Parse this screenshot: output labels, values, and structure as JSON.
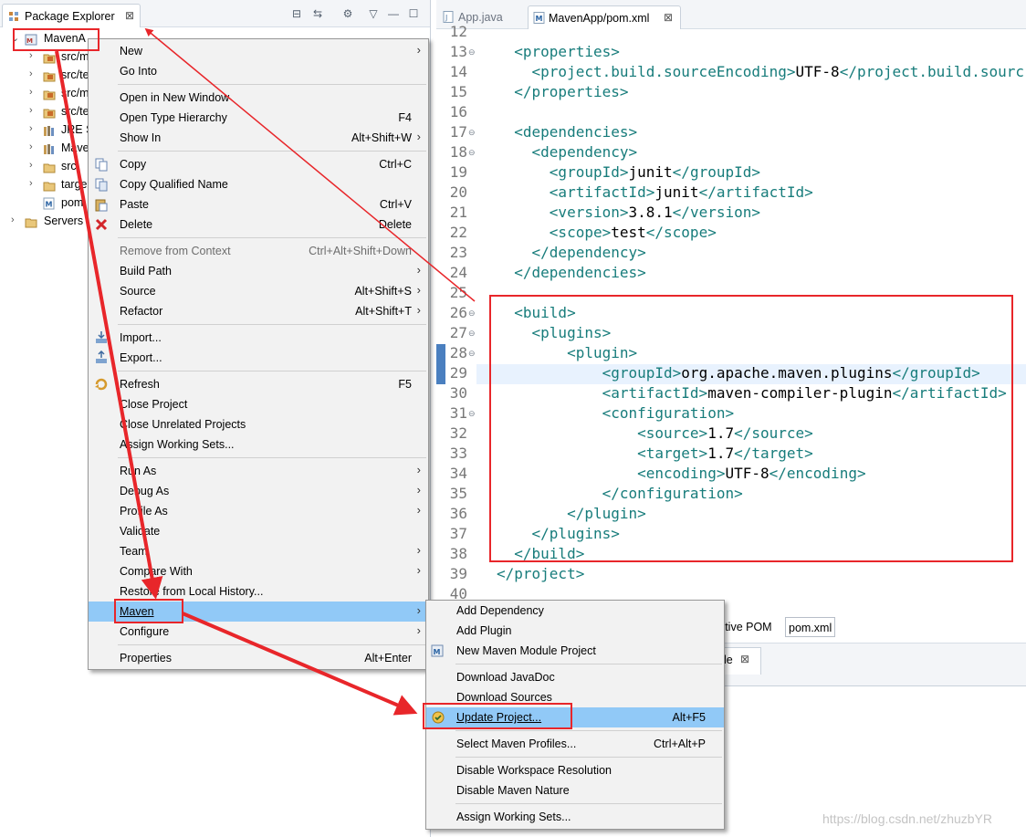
{
  "explorer": {
    "title": "Package Explorer",
    "close": "⊠",
    "toolbar": [
      "⊟",
      "⇆",
      "⚙",
      "▽",
      "—",
      "☐"
    ],
    "items": [
      {
        "label": "MavenA",
        "arrow": "⌄",
        "icon": "maven-project-icon"
      },
      {
        "label": "src/m",
        "arrow": "›",
        "icon": "source-folder-icon"
      },
      {
        "label": "src/te",
        "arrow": "›",
        "icon": "source-folder-icon"
      },
      {
        "label": "src/m",
        "arrow": "›",
        "icon": "source-folder-icon"
      },
      {
        "label": "src/te",
        "arrow": "›",
        "icon": "source-folder-icon"
      },
      {
        "label": "JRE S",
        "arrow": "›",
        "icon": "library-icon"
      },
      {
        "label": "Mave",
        "arrow": "›",
        "icon": "library-icon"
      },
      {
        "label": "src",
        "arrow": "›",
        "icon": "folder-icon"
      },
      {
        "label": "targe",
        "arrow": "›",
        "icon": "folder-icon"
      },
      {
        "label": "pom",
        "arrow": "",
        "icon": "pom-file-icon"
      },
      {
        "label": "Servers",
        "arrow": "›",
        "icon": "folder-icon"
      }
    ]
  },
  "editor": {
    "tabs": [
      {
        "label": "App.java",
        "close": ""
      },
      {
        "label": "MavenApp/pom.xml",
        "close": "⊠"
      }
    ],
    "lines": [
      {
        "n": "12",
        "parts": [
          [
            "",
            ""
          ]
        ]
      },
      {
        "n": "13",
        "fold": "⊖",
        "parts": [
          [
            "",
            "  "
          ],
          [
            "tag",
            "<properties>"
          ]
        ]
      },
      {
        "n": "14",
        "parts": [
          [
            "",
            "    "
          ],
          [
            "tag",
            "<project.build.sourceEncoding>"
          ],
          [
            "",
            "UTF-8"
          ],
          [
            "tag",
            "</project.build.sourc"
          ]
        ]
      },
      {
        "n": "15",
        "parts": [
          [
            "",
            "  "
          ],
          [
            "tag",
            "</properties>"
          ]
        ]
      },
      {
        "n": "16",
        "parts": [
          [
            "",
            ""
          ]
        ]
      },
      {
        "n": "17",
        "fold": "⊖",
        "parts": [
          [
            "",
            "  "
          ],
          [
            "tag",
            "<dependencies>"
          ]
        ]
      },
      {
        "n": "18",
        "fold": "⊖",
        "parts": [
          [
            "",
            "    "
          ],
          [
            "tag",
            "<dependency>"
          ]
        ]
      },
      {
        "n": "19",
        "parts": [
          [
            "",
            "      "
          ],
          [
            "tag",
            "<groupId>"
          ],
          [
            "",
            "junit"
          ],
          [
            "tag",
            "</groupId>"
          ]
        ]
      },
      {
        "n": "20",
        "parts": [
          [
            "",
            "      "
          ],
          [
            "tag",
            "<artifactId>"
          ],
          [
            "",
            "junit"
          ],
          [
            "tag",
            "</artifactId>"
          ]
        ]
      },
      {
        "n": "21",
        "parts": [
          [
            "",
            "      "
          ],
          [
            "tag",
            "<version>"
          ],
          [
            "",
            "3.8.1"
          ],
          [
            "tag",
            "</version>"
          ]
        ]
      },
      {
        "n": "22",
        "parts": [
          [
            "",
            "      "
          ],
          [
            "tag",
            "<scope>"
          ],
          [
            "",
            "test"
          ],
          [
            "tag",
            "</scope>"
          ]
        ]
      },
      {
        "n": "23",
        "parts": [
          [
            "",
            "    "
          ],
          [
            "tag",
            "</dependency>"
          ]
        ]
      },
      {
        "n": "24",
        "parts": [
          [
            "",
            "  "
          ],
          [
            "tag",
            "</dependencies>"
          ]
        ]
      },
      {
        "n": "25",
        "parts": [
          [
            "",
            ""
          ]
        ]
      },
      {
        "n": "26",
        "fold": "⊖",
        "parts": [
          [
            "",
            "  "
          ],
          [
            "tag",
            "<build>"
          ]
        ]
      },
      {
        "n": "27",
        "fold": "⊖",
        "parts": [
          [
            "",
            "    "
          ],
          [
            "tag",
            "<plugins>"
          ]
        ]
      },
      {
        "n": "28",
        "fold": "⊖",
        "parts": [
          [
            "",
            "        "
          ],
          [
            "tag",
            "<plugin>"
          ]
        ]
      },
      {
        "n": "29",
        "parts": [
          [
            "",
            "            "
          ],
          [
            "tag",
            "<groupId>"
          ],
          [
            "",
            "org.apache.maven.plugins"
          ],
          [
            "tag",
            "</groupId>"
          ]
        ]
      },
      {
        "n": "30",
        "parts": [
          [
            "",
            "            "
          ],
          [
            "tag",
            "<artifactId>"
          ],
          [
            "",
            "maven-compiler-plugin"
          ],
          [
            "tag",
            "</artifactId>"
          ]
        ]
      },
      {
        "n": "31",
        "fold": "⊖",
        "parts": [
          [
            "",
            "            "
          ],
          [
            "tag",
            "<configuration>"
          ]
        ]
      },
      {
        "n": "32",
        "parts": [
          [
            "",
            "                "
          ],
          [
            "tag",
            "<source>"
          ],
          [
            "",
            "1.7"
          ],
          [
            "tag",
            "</source>"
          ]
        ]
      },
      {
        "n": "33",
        "parts": [
          [
            "",
            "                "
          ],
          [
            "tag",
            "<target>"
          ],
          [
            "",
            "1.7"
          ],
          [
            "tag",
            "</target>"
          ]
        ]
      },
      {
        "n": "34",
        "parts": [
          [
            "",
            "                "
          ],
          [
            "tag",
            "<encoding>"
          ],
          [
            "",
            "UTF-8"
          ],
          [
            "tag",
            "</encoding>"
          ]
        ]
      },
      {
        "n": "35",
        "parts": [
          [
            "",
            "            "
          ],
          [
            "tag",
            "</configuration>"
          ]
        ]
      },
      {
        "n": "36",
        "parts": [
          [
            "",
            "        "
          ],
          [
            "tag",
            "</plugin>"
          ]
        ]
      },
      {
        "n": "37",
        "parts": [
          [
            "",
            "    "
          ],
          [
            "tag",
            "</plugins>"
          ]
        ]
      },
      {
        "n": "38",
        "parts": [
          [
            "",
            "  "
          ],
          [
            "tag",
            "</build>"
          ]
        ]
      },
      {
        "n": "39",
        "parts": [
          [
            "tag",
            "</project>"
          ]
        ]
      },
      {
        "n": "40",
        "parts": [
          [
            "",
            ""
          ]
        ]
      }
    ],
    "bottom_tabs": [
      "ective POM",
      "pom.xml"
    ],
    "console_tab": "le",
    "console_close": "⊠"
  },
  "context_menu": {
    "items": [
      {
        "label": "New",
        "sub": true
      },
      {
        "label": "Go Into"
      },
      {
        "sep": true
      },
      {
        "label": "Open in New Window"
      },
      {
        "label": "Open Type Hierarchy",
        "shortcut": "F4"
      },
      {
        "label": "Show In",
        "shortcut": "Alt+Shift+W",
        "sub": true
      },
      {
        "sep": true
      },
      {
        "label": "Copy",
        "shortcut": "Ctrl+C",
        "icon": "copy-icon"
      },
      {
        "label": "Copy Qualified Name",
        "icon": "copy-qualified-icon"
      },
      {
        "label": "Paste",
        "shortcut": "Ctrl+V",
        "icon": "paste-icon"
      },
      {
        "label": "Delete",
        "shortcut": "Delete",
        "icon": "delete-icon"
      },
      {
        "sep": true
      },
      {
        "label": "Remove from Context",
        "shortcut": "Ctrl+Alt+Shift+Down",
        "disabled": true
      },
      {
        "label": "Build Path",
        "sub": true
      },
      {
        "label": "Source",
        "shortcut": "Alt+Shift+S",
        "sub": true
      },
      {
        "label": "Refactor",
        "shortcut": "Alt+Shift+T",
        "sub": true
      },
      {
        "sep": true
      },
      {
        "label": "Import...",
        "icon": "import-icon"
      },
      {
        "label": "Export...",
        "icon": "export-icon"
      },
      {
        "sep": true
      },
      {
        "label": "Refresh",
        "shortcut": "F5",
        "icon": "refresh-icon"
      },
      {
        "label": "Close Project"
      },
      {
        "label": "Close Unrelated Projects"
      },
      {
        "label": "Assign Working Sets..."
      },
      {
        "sep": true
      },
      {
        "label": "Run As",
        "sub": true
      },
      {
        "label": "Debug As",
        "sub": true
      },
      {
        "label": "Profile As",
        "sub": true
      },
      {
        "label": "Validate"
      },
      {
        "label": "Team",
        "sub": true
      },
      {
        "label": "Compare With",
        "sub": true
      },
      {
        "label": "Restore from Local History..."
      },
      {
        "label": "Maven",
        "sub": true,
        "selected": true
      },
      {
        "label": "Configure",
        "sub": true
      },
      {
        "sep": true
      },
      {
        "label": "Properties",
        "shortcut": "Alt+Enter"
      }
    ]
  },
  "maven_menu": {
    "items": [
      {
        "label": "Add Dependency"
      },
      {
        "label": "Add Plugin"
      },
      {
        "label": "New Maven Module Project",
        "icon": "maven-module-icon"
      },
      {
        "sep": true
      },
      {
        "label": "Download JavaDoc"
      },
      {
        "label": "Download Sources"
      },
      {
        "label": "Update Project...",
        "shortcut": "Alt+F5",
        "icon": "update-project-icon",
        "selected": true
      },
      {
        "sep": true
      },
      {
        "label": "Select Maven Profiles...",
        "shortcut": "Ctrl+Alt+P"
      },
      {
        "sep": true
      },
      {
        "label": "Disable Workspace Resolution"
      },
      {
        "label": "Disable Maven Nature"
      },
      {
        "sep": true
      },
      {
        "label": "Assign Working Sets..."
      }
    ]
  },
  "watermark": "https://blog.csdn.net/zhuzbYR",
  "colors": {
    "annotation": "#e8262a",
    "xml_tag": "#177c7b",
    "selection": "#91c9f7"
  }
}
